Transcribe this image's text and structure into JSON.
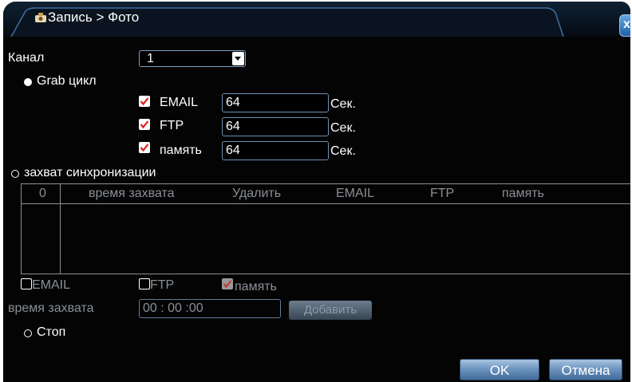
{
  "window": {
    "title": "Запись > Фото",
    "close_label": "x"
  },
  "form": {
    "channel_label": "Канал",
    "channel_value": "1",
    "grab_cycle_label": "Grab цикл",
    "rows": [
      {
        "label": "EMAIL",
        "value": "64",
        "unit": "Сек.",
        "checked": true
      },
      {
        "label": "FTP",
        "value": "64",
        "unit": "Сек.",
        "checked": true
      },
      {
        "label": "память",
        "value": "64",
        "unit": "Сек.",
        "checked": true
      }
    ],
    "sync_capture_label": "захват синхронизации",
    "table": {
      "columns": [
        "0",
        "время захвата",
        "Удалить",
        "EMAIL",
        "FTP",
        "память"
      ]
    },
    "email_cb_label": "EMAIL",
    "ftp_cb_label": "FTP",
    "memory_cb_label": "память",
    "capture_time_label": "время захвата",
    "capture_time_value": "00 : 00 :00",
    "add_button": "Добавить",
    "stop_label": "Стоп"
  },
  "buttons": {
    "ok": "OK",
    "cancel": "Отмена"
  },
  "colors": {
    "background": "#040404",
    "field_border": "#6d8fb5",
    "accent": "#6f96c0",
    "check": "#d9211f"
  }
}
